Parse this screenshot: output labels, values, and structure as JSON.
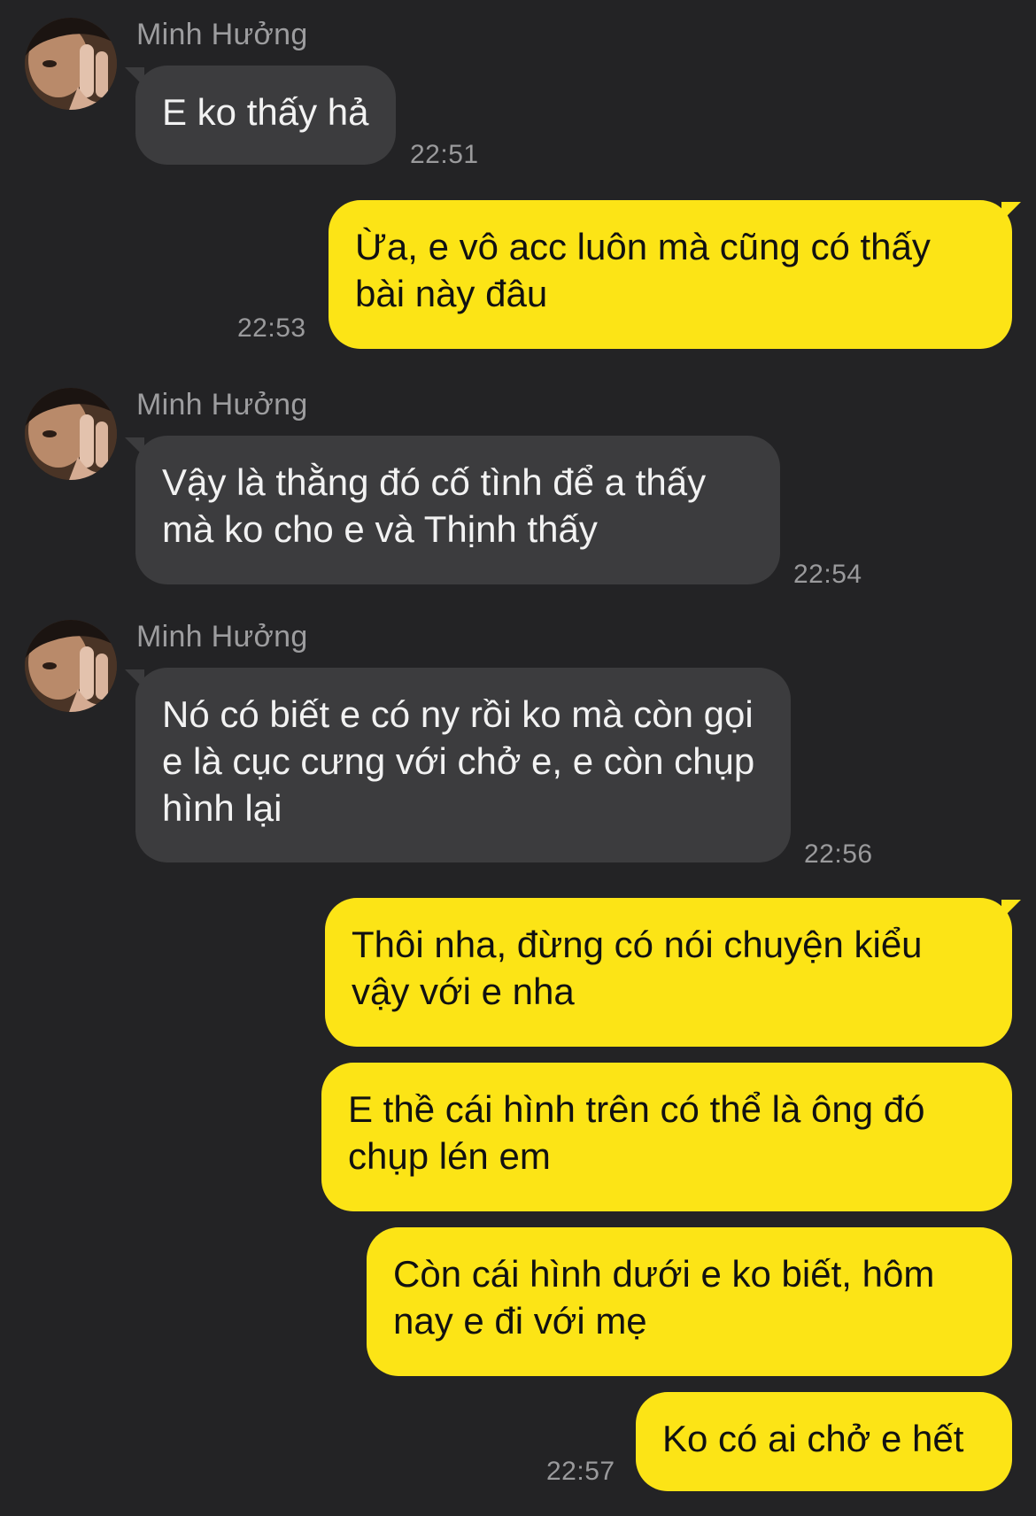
{
  "conversation": {
    "messages": [
      {
        "sender": "Minh Hưởng",
        "text": "E ko thấy hả",
        "time": "22:51",
        "direction": "incoming"
      },
      {
        "text": "Ừa, e vô acc luôn mà cũng có thấy bài này đâu",
        "time": "22:53",
        "direction": "outgoing"
      },
      {
        "sender": "Minh Hưởng",
        "text": "Vậy là thằng đó cố tình để a thấy mà ko cho e và Thịnh thấy",
        "time": "22:54",
        "direction": "incoming"
      },
      {
        "sender": "Minh Hưởng",
        "text": "Nó có biết e có ny rồi ko mà còn gọi e là cục cưng với chở e, e còn chụp hình lại",
        "time": "22:56",
        "direction": "incoming"
      },
      {
        "text": "Thôi nha, đừng có nói chuyện kiểu vậy với e nha",
        "direction": "outgoing"
      },
      {
        "text": "E thề cái hình trên có thể là ông đó chụp lén em",
        "direction": "outgoing"
      },
      {
        "text": "Còn cái hình dưới e ko biết, hôm nay e đi với mẹ",
        "direction": "outgoing"
      },
      {
        "text": "Ko có ai chở e hết",
        "time": "22:57",
        "direction": "outgoing"
      }
    ]
  },
  "colors": {
    "background": "#232325",
    "incoming_bubble": "#3c3c3e",
    "outgoing_bubble": "#fce416",
    "timestamp": "#9a9a9c",
    "sender_name": "#9d9d9f"
  },
  "icons": {
    "avatar": "contact-avatar-photo"
  }
}
